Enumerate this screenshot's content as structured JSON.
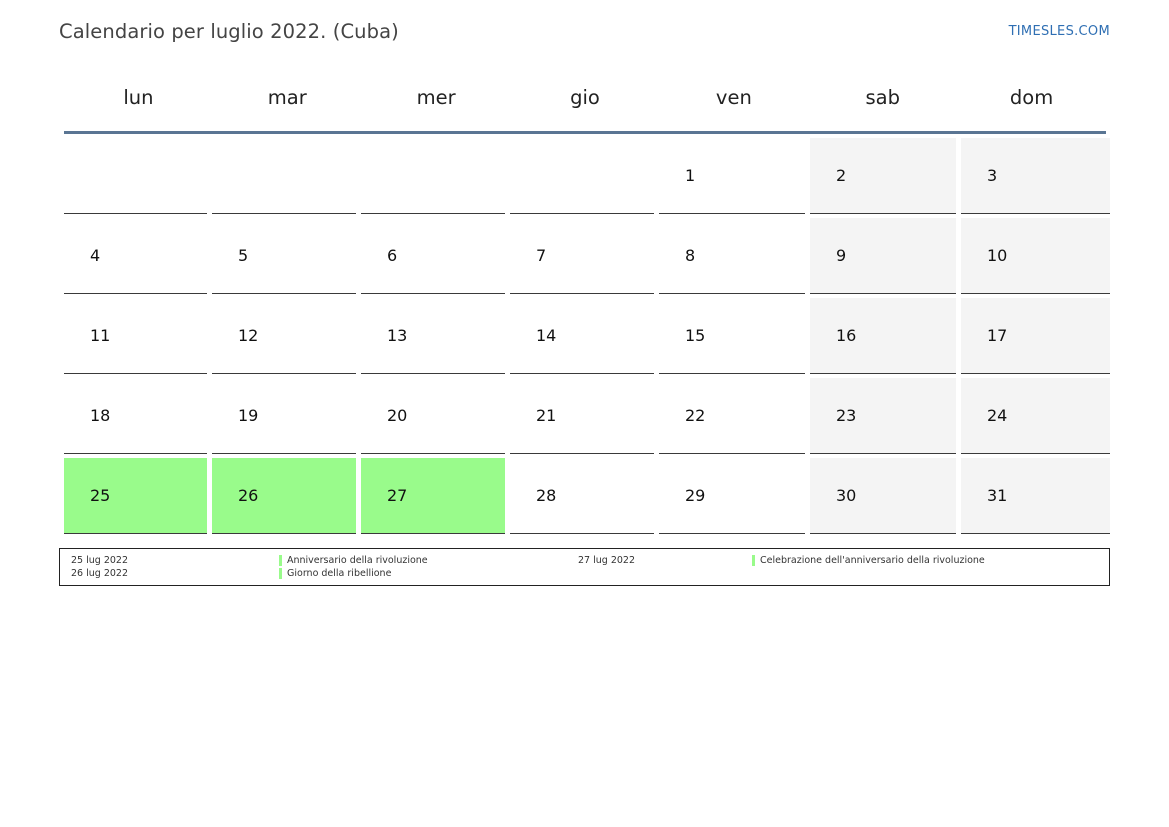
{
  "header": {
    "title": "Calendario per luglio 2022. (Cuba)",
    "site": "TIMESLES.COM"
  },
  "weekdays": [
    "lun",
    "mar",
    "mer",
    "gio",
    "ven",
    "sab",
    "dom"
  ],
  "calendar": {
    "weeks": [
      [
        "",
        "",
        "",
        "",
        "1",
        "2",
        "3"
      ],
      [
        "4",
        "5",
        "6",
        "7",
        "8",
        "9",
        "10"
      ],
      [
        "11",
        "12",
        "13",
        "14",
        "15",
        "16",
        "17"
      ],
      [
        "18",
        "19",
        "20",
        "21",
        "22",
        "23",
        "24"
      ],
      [
        "25",
        "26",
        "27",
        "28",
        "29",
        "30",
        "31"
      ]
    ],
    "holiday_days": [
      "25",
      "26",
      "27"
    ],
    "weekend_color": "#f4f4f4",
    "holiday_color": "#99fb8b"
  },
  "legend": [
    {
      "date": "25 lug 2022",
      "name": "Anniversario della rivoluzione"
    },
    {
      "date": "26 lug 2022",
      "name": "Giorno della ribellione"
    },
    {
      "date": "27 lug 2022",
      "name": "Celebrazione dell'anniversario della rivoluzione"
    }
  ]
}
